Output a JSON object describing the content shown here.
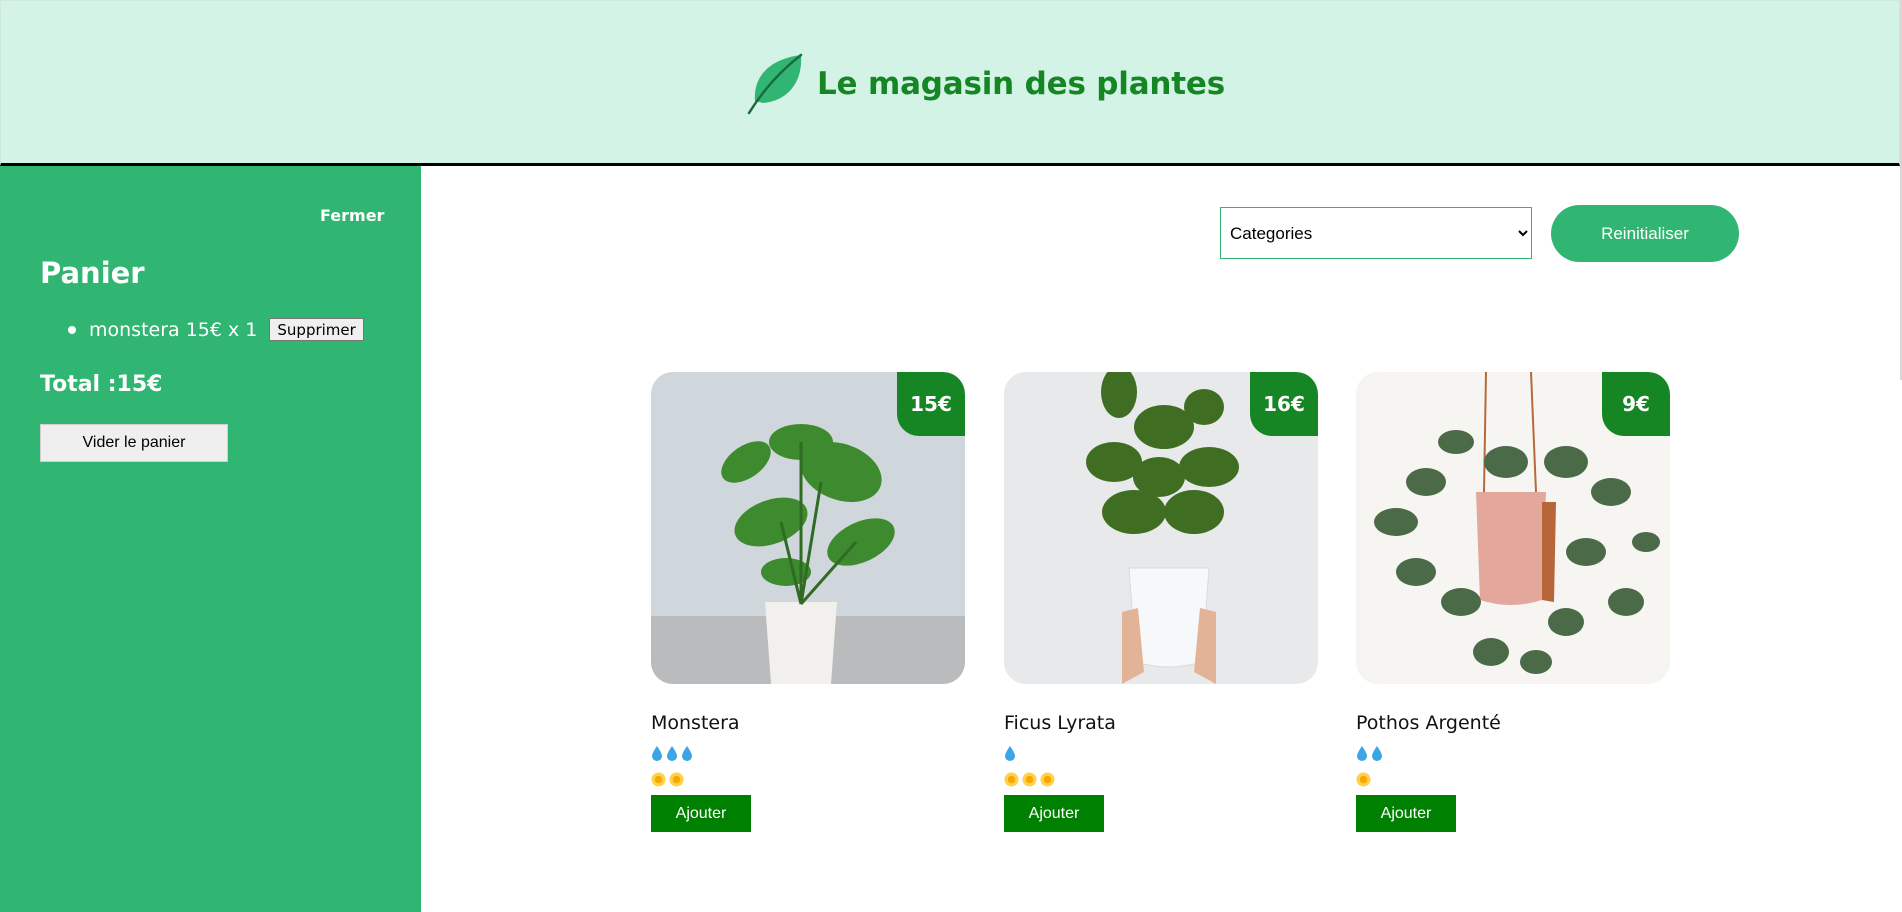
{
  "header": {
    "title": "Le magasin des plantes",
    "logo_icon": "leaf-icon",
    "brand_color": "#168524",
    "background": "#d2f3e6"
  },
  "cart": {
    "close_label": "Fermer",
    "title": "Panier",
    "items": [
      {
        "text": "monstera 15€ x 1",
        "remove_label": "Supprimer"
      }
    ],
    "total": "Total :15€",
    "empty_label": "Vider le panier",
    "background": "#31b572"
  },
  "filters": {
    "category_selected": "Categories",
    "reset_label": "Reinitialiser"
  },
  "plants": [
    {
      "name": "Monstera",
      "price": "15€",
      "water_level": 3,
      "light_level": 2,
      "add_label": "Ajouter"
    },
    {
      "name": "Ficus Lyrata",
      "price": "16€",
      "water_level": 1,
      "light_level": 3,
      "add_label": "Ajouter"
    },
    {
      "name": "Pothos Argenté",
      "price": "9€",
      "water_level": 2,
      "light_level": 1,
      "add_label": "Ajouter"
    }
  ]
}
